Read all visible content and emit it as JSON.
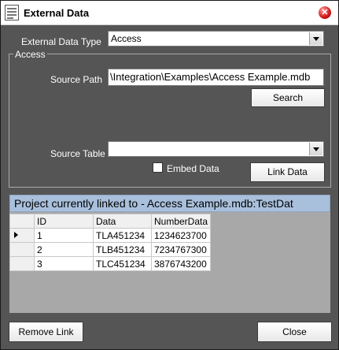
{
  "window": {
    "title": "External Data"
  },
  "form": {
    "type_label": "External Data Type",
    "type_value": "Access",
    "group_label": "Access",
    "source_path_label": "Source Path",
    "source_path_value": "\\Integration\\Examples\\Access Example.mdb",
    "search_label": "Search",
    "source_table_label": "Source Table",
    "source_table_value": "",
    "embed_label": "Embed Data",
    "embed_checked": false,
    "link_label": "Link Data"
  },
  "linked": {
    "text": "Project currently linked to - Access Example.mdb:TestDat"
  },
  "grid": {
    "columns": [
      "ID",
      "Data",
      "NumberData"
    ],
    "rows": [
      [
        "1",
        "TLA451234",
        "1234623700"
      ],
      [
        "2",
        "TLB451234",
        "7234767300"
      ],
      [
        "3",
        "TLC451234",
        "3876743200"
      ]
    ],
    "current_row_index": 0
  },
  "footer": {
    "remove_label": "Remove Link",
    "close_label": "Close"
  },
  "colors": {
    "background": "#555555",
    "linked_bar": "#a9c0dc",
    "grid_area": "#a8a8a8",
    "close_icon": "#d01818"
  }
}
